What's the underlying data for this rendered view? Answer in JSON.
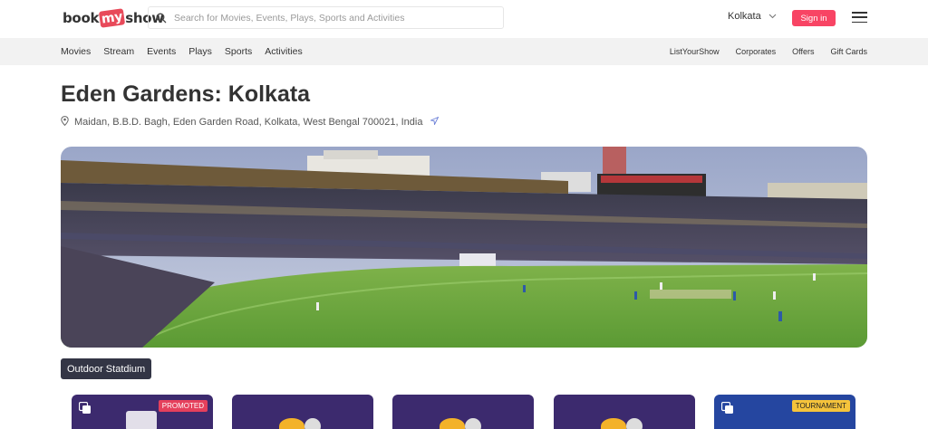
{
  "header": {
    "logo_part1": "book",
    "logo_part2": "my",
    "logo_part3": "show",
    "search_placeholder": "Search for Movies, Events, Plays, Sports and Activities",
    "city": "Kolkata",
    "signin_label": "Sign in"
  },
  "subnav": {
    "left": [
      "Movies",
      "Stream",
      "Events",
      "Plays",
      "Sports",
      "Activities"
    ],
    "right": [
      "ListYourShow",
      "Corporates",
      "Offers",
      "Gift Cards"
    ]
  },
  "venue": {
    "title": "Eden Gardens: Kolkata",
    "address": "Maidan, B.B.D. Bagh, Eden Garden Road, Kolkata, West Bengal 700021, India",
    "category_tag": "Outdoor Statdium"
  },
  "cards": [
    {
      "badge": "PROMOTED",
      "badge_color": "#e5405c"
    },
    {
      "badge": ""
    },
    {
      "badge": ""
    },
    {
      "badge": ""
    },
    {
      "badge": "TOURNAMENT",
      "badge_color": "#f5c33b"
    }
  ],
  "colors": {
    "brand": "#f84464",
    "tag_bg": "#333545",
    "subnav_bg": "#f2f2f2"
  }
}
